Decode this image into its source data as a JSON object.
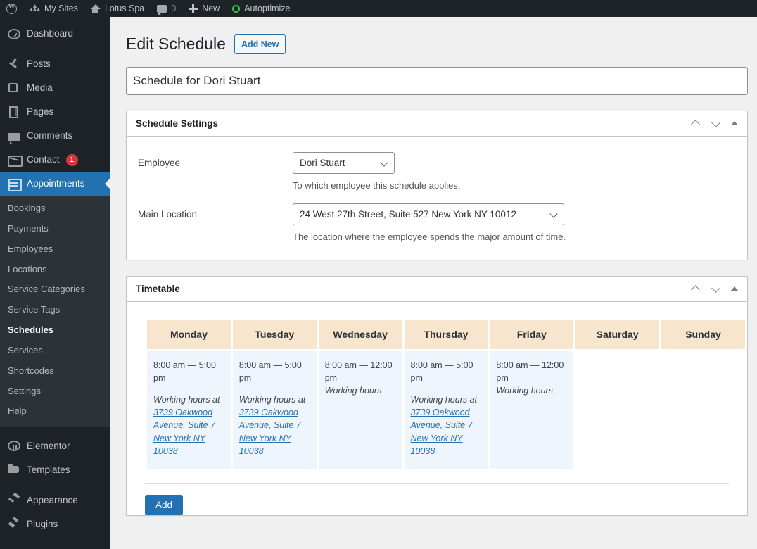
{
  "adminbar": {
    "items": [
      {
        "icon": "wordpress-logo-icon",
        "label": ""
      },
      {
        "icon": "my-sites-icon",
        "label": "My Sites"
      },
      {
        "icon": "home-icon",
        "label": "Lotus Spa"
      },
      {
        "icon": "comment-icon",
        "label": "0"
      },
      {
        "icon": "plus-icon",
        "label": "New"
      },
      {
        "icon": "autoptimize-icon",
        "label": "Autoptimize"
      }
    ]
  },
  "sidebar": {
    "items": [
      {
        "label": "Dashboard",
        "icon": "dashboard-icon"
      },
      {
        "label": "Posts",
        "icon": "pin-icon"
      },
      {
        "label": "Media",
        "icon": "media-icon"
      },
      {
        "label": "Pages",
        "icon": "pages-icon"
      },
      {
        "label": "Comments",
        "icon": "comments-icon"
      },
      {
        "label": "Contact",
        "icon": "mail-icon",
        "badge": "1"
      },
      {
        "label": "Appointments",
        "icon": "calendar-icon",
        "active": true
      }
    ],
    "submenu": [
      {
        "label": "Bookings"
      },
      {
        "label": "Payments"
      },
      {
        "label": "Employees"
      },
      {
        "label": "Locations"
      },
      {
        "label": "Service Categories"
      },
      {
        "label": "Service Tags"
      },
      {
        "label": "Schedules",
        "current": true
      },
      {
        "label": "Services"
      },
      {
        "label": "Shortcodes"
      },
      {
        "label": "Settings"
      },
      {
        "label": "Help"
      }
    ],
    "items_bottom": [
      {
        "label": "Elementor",
        "icon": "elementor-icon"
      },
      {
        "label": "Templates",
        "icon": "folder-icon"
      },
      {
        "label": "Appearance",
        "icon": "brush-icon"
      },
      {
        "label": "Plugins",
        "icon": "plug-icon"
      }
    ]
  },
  "page": {
    "title": "Edit Schedule",
    "add_new_label": "Add New",
    "schedule_title_value": "Schedule for Dori Stuart",
    "schedule_title_placeholder": "Add title"
  },
  "settings_panel": {
    "title": "Schedule Settings",
    "employee_label": "Employee",
    "employee_value": "Dori Stuart",
    "employee_desc": "To which employee this schedule applies.",
    "location_label": "Main Location",
    "location_value": "24 West 27th Street, Suite 527 New York NY 10012",
    "location_desc": "The location where the employee spends the major amount of time."
  },
  "timetable_panel": {
    "title": "Timetable",
    "add_label": "Add",
    "days": [
      "Monday",
      "Tuesday",
      "Wednesday",
      "Thursday",
      "Friday",
      "Saturday",
      "Sunday"
    ],
    "slots": [
      {
        "day": "Monday",
        "time": "8:00 am — 5:00 pm",
        "note": "Working hours at",
        "location": "3739 Oakwood Avenue, Suite 7 New York NY 10038"
      },
      {
        "day": "Tuesday",
        "time": "8:00 am — 5:00 pm",
        "note": "Working hours at",
        "location": "3739 Oakwood Avenue, Suite 7 New York NY 10038"
      },
      {
        "day": "Wednesday",
        "time": "8:00 am — 12:00 pm",
        "note": "Working hours",
        "location": ""
      },
      {
        "day": "Thursday",
        "time": "8:00 am — 5:00 pm",
        "note": "Working hours at",
        "location": "3739 Oakwood Avenue, Suite 7 New York NY 10038"
      },
      {
        "day": "Friday",
        "time": "8:00 am — 12:00 pm",
        "note": "Working hours",
        "location": ""
      },
      {
        "day": "Saturday",
        "time": "",
        "note": "",
        "location": ""
      },
      {
        "day": "Sunday",
        "time": "",
        "note": "",
        "location": ""
      }
    ]
  },
  "colors": {
    "admin_dark": "#1d2327",
    "accent_blue": "#2271b1",
    "header_beige": "#f8e5cd",
    "cell_blue": "#eef5fc",
    "badge_red": "#d63638",
    "green": "#2ecc40"
  }
}
